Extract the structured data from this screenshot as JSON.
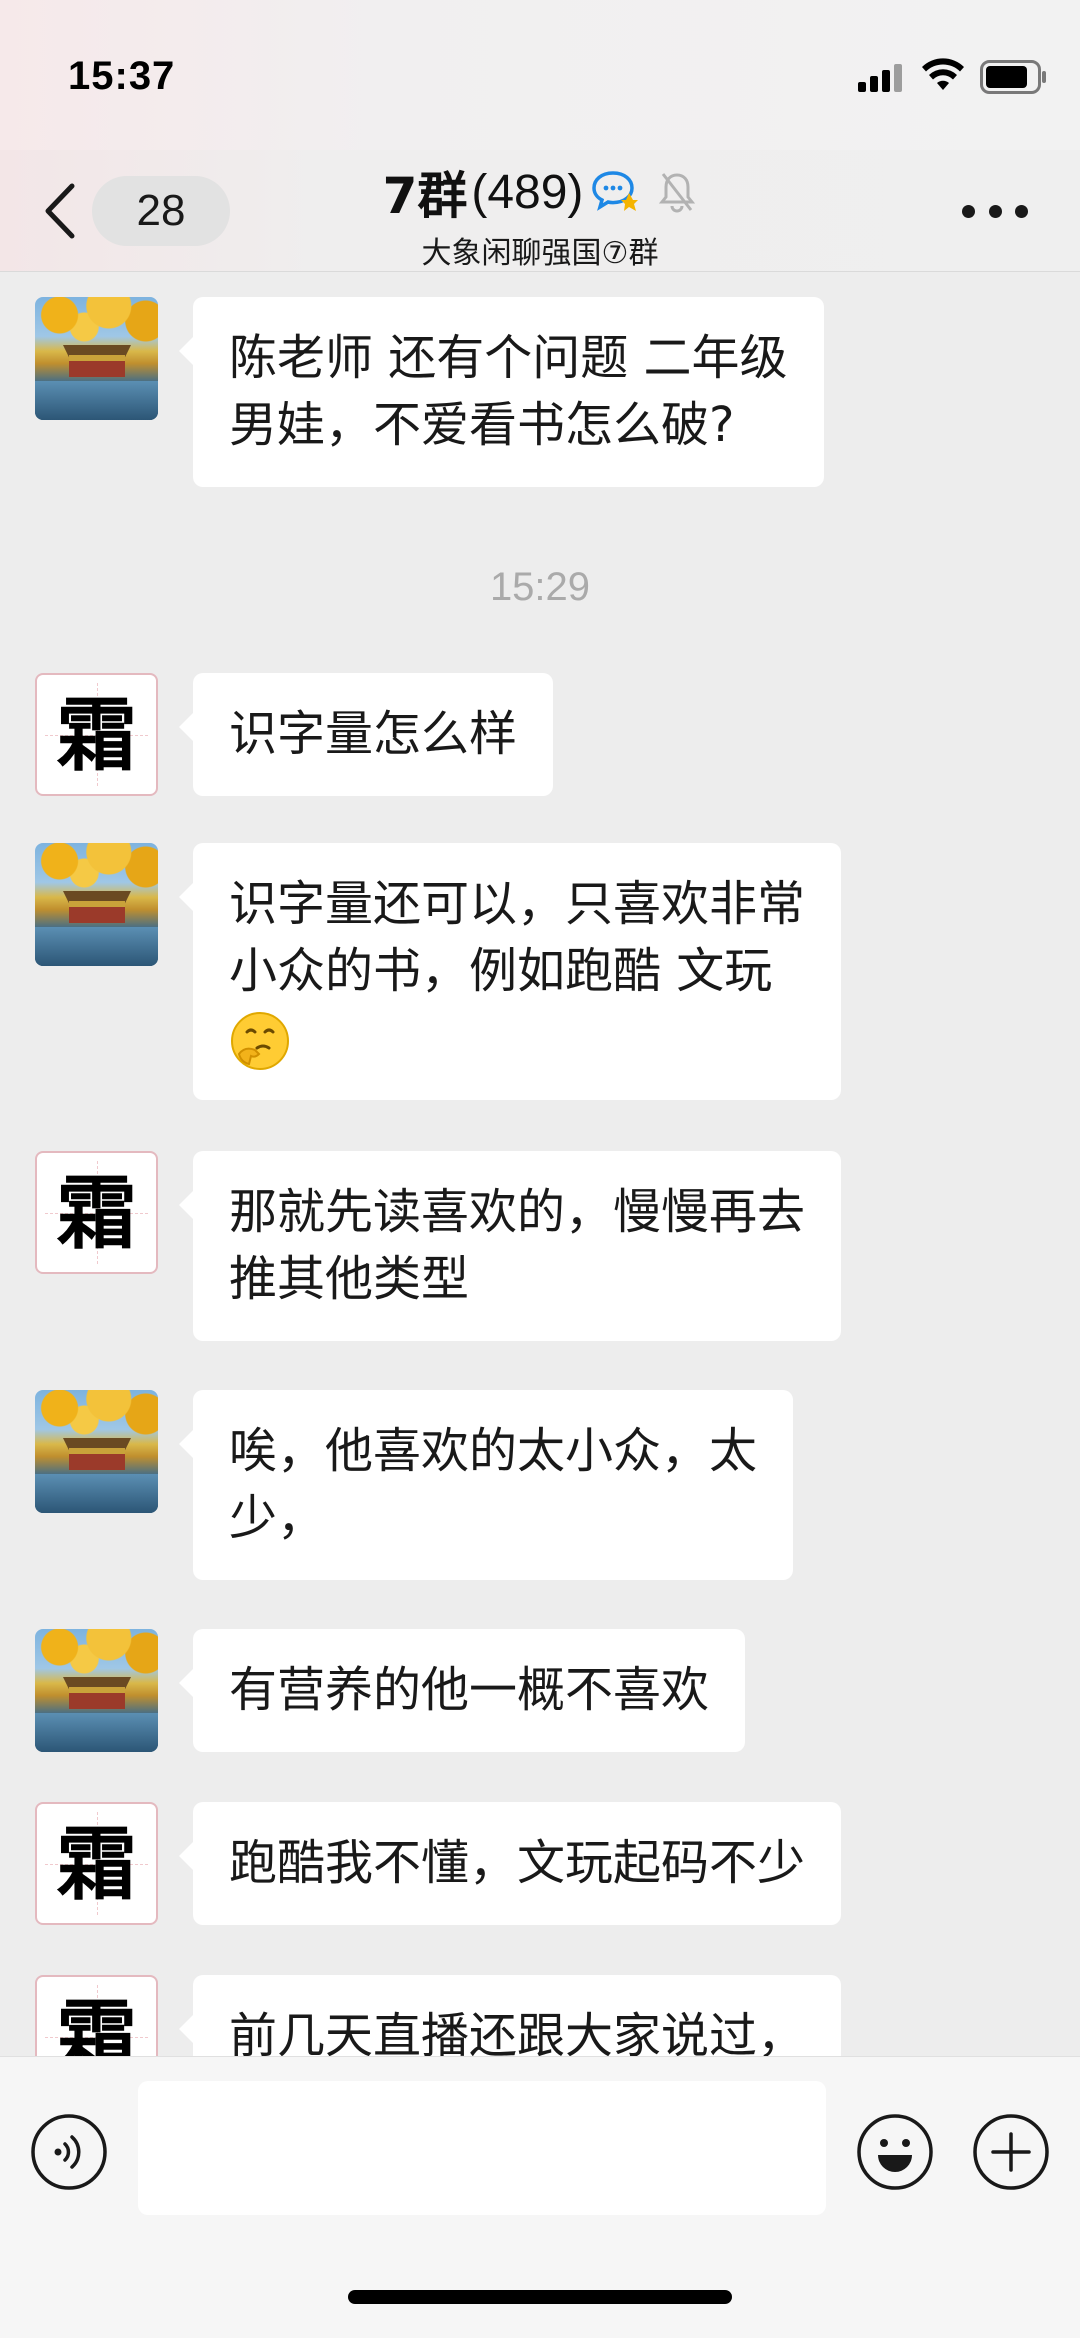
{
  "status_bar": {
    "time": "15:37",
    "icons": [
      "signal-icon",
      "wifi-icon",
      "battery-icon"
    ]
  },
  "header": {
    "unread_count": "28",
    "title": "7群",
    "member_count": "(489)",
    "subtitle": "大象闲聊强国⑦群",
    "icons": [
      "back-chevron-icon",
      "chat-badge-icon",
      "mute-bell-icon",
      "more-icon"
    ]
  },
  "messages": [
    {
      "avatar": "scenery",
      "lines": [
        "陈老师 还有个问题 二年级",
        "男娃，不爱看书怎么破?"
      ]
    },
    {
      "timestamp": "15:29"
    },
    {
      "avatar": "char",
      "avatar_char": "霜",
      "lines": [
        "识字量怎么样"
      ]
    },
    {
      "avatar": "scenery",
      "lines": [
        "识字量还可以，只喜欢非常",
        "小众的书，例如跑酷 文玩"
      ],
      "emoji": "thinking-face-emoji"
    },
    {
      "avatar": "char",
      "avatar_char": "霜",
      "lines": [
        "那就先读喜欢的，慢慢再去",
        "推其他类型"
      ]
    },
    {
      "avatar": "scenery",
      "lines": [
        "唉，他喜欢的太小众，太",
        "少，"
      ]
    },
    {
      "avatar": "scenery",
      "lines": [
        "有营养的他一概不喜欢"
      ]
    },
    {
      "avatar": "char",
      "avatar_char": "霜",
      "lines": [
        "跑酷我不懂，文玩起码不少"
      ]
    },
    {
      "avatar": "char",
      "avatar_char": "霜",
      "lines": [
        "前几天直播还跟大家说过，"
      ]
    }
  ],
  "input_bar": {
    "placeholder": "",
    "icons": [
      "voice-icon",
      "emoji-icon",
      "plus-icon"
    ]
  },
  "colors": {
    "background": "#ededed",
    "bubble": "#ffffff",
    "timestamp": "#aaaaaa",
    "chat_badge_blue": "#1e88e5",
    "chat_badge_yellow": "#f5b400"
  }
}
